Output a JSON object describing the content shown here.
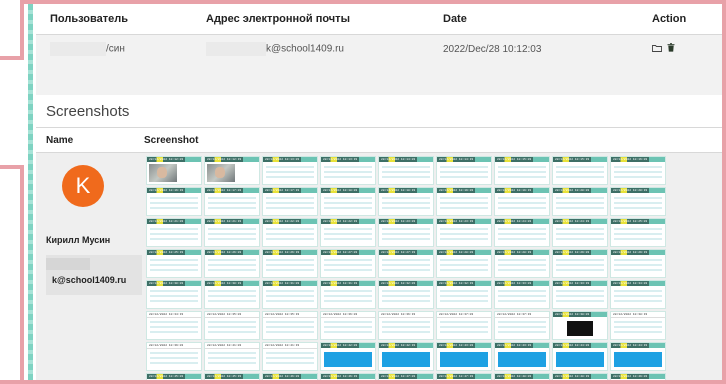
{
  "table": {
    "headers": {
      "user": "Пользователь",
      "email": "Адрес электронной почты",
      "date": "Date",
      "action": "Action"
    },
    "rows": [
      {
        "user_fragment": "/син",
        "email_fragment": "k@school1409.ru",
        "date": "2022/Dec/28 10:12:03"
      }
    ],
    "action_icons": [
      "folder-icon",
      "trash-icon"
    ]
  },
  "screenshots": {
    "title": "Screenshots",
    "headers": {
      "name": "Name",
      "screenshot": "Screenshot"
    },
    "profile": {
      "avatar_letter": "K",
      "name": "Кирилл Мусин",
      "email": "k@school1409.ru",
      "avatar_color": "#f06a1c"
    },
    "thumbnails": [
      {
        "time": "28/12/2022 10:12:03",
        "kind": "webcam"
      },
      {
        "time": "28/12/2022 10:12:33",
        "kind": "webcam"
      },
      {
        "time": "28/12/2022 10:13:03",
        "kind": "doc"
      },
      {
        "time": "28/12/2022 10:13:33",
        "kind": "doc"
      },
      {
        "time": "28/12/2022 10:14:03",
        "kind": "doc"
      },
      {
        "time": "28/12/2022 10:14:33",
        "kind": "doc"
      },
      {
        "time": "28/12/2022 10:15:03",
        "kind": "doc"
      },
      {
        "time": "28/12/2022 10:15:33",
        "kind": "doc"
      },
      {
        "time": "28/12/2022 10:16:03",
        "kind": "doc"
      },
      {
        "time": "28/12/2022 10:16:33",
        "kind": "doc"
      },
      {
        "time": "28/12/2022 10:17:03",
        "kind": "doc"
      },
      {
        "time": "28/12/2022 10:17:33",
        "kind": "doc"
      },
      {
        "time": "28/12/2022 10:18:03",
        "kind": "doc"
      },
      {
        "time": "28/12/2022 10:18:33",
        "kind": "doc"
      },
      {
        "time": "28/12/2022 10:19:03",
        "kind": "doc"
      },
      {
        "time": "28/12/2022 10:19:33",
        "kind": "doc"
      },
      {
        "time": "28/12/2022 10:20:03",
        "kind": "doc"
      },
      {
        "time": "28/12/2022 10:20:33",
        "kind": "doc"
      },
      {
        "time": "28/12/2022 10:21:03",
        "kind": "doc"
      },
      {
        "time": "28/12/2022 10:21:33",
        "kind": "doc"
      },
      {
        "time": "28/12/2022 10:22:03",
        "kind": "doc"
      },
      {
        "time": "28/12/2022 10:22:33",
        "kind": "doc"
      },
      {
        "time": "28/12/2022 10:23:03",
        "kind": "doc"
      },
      {
        "time": "28/12/2022 10:23:33",
        "kind": "doc"
      },
      {
        "time": "28/12/2022 10:24:03",
        "kind": "doc"
      },
      {
        "time": "28/12/2022 10:24:33",
        "kind": "doc"
      },
      {
        "time": "28/12/2022 10:25:03",
        "kind": "doc"
      },
      {
        "time": "28/12/2022 10:25:33",
        "kind": "doc"
      },
      {
        "time": "28/12/2022 10:26:03",
        "kind": "doc"
      },
      {
        "time": "28/12/2022 10:26:33",
        "kind": "doc"
      },
      {
        "time": "28/12/2022 10:27:03",
        "kind": "doc"
      },
      {
        "time": "28/12/2022 10:27:33",
        "kind": "doc"
      },
      {
        "time": "28/12/2022 10:28:03",
        "kind": "doc"
      },
      {
        "time": "28/12/2022 10:28:33",
        "kind": "doc"
      },
      {
        "time": "28/12/2022 10:29:03",
        "kind": "doc"
      },
      {
        "time": "28/12/2022 10:29:33",
        "kind": "doc"
      },
      {
        "time": "28/12/2022 10:30:03",
        "kind": "doc"
      },
      {
        "time": "28/12/2022 10:30:33",
        "kind": "doc"
      },
      {
        "time": "28/12/2022 10:31:03",
        "kind": "doc"
      },
      {
        "time": "28/12/2022 10:31:33",
        "kind": "doc"
      },
      {
        "time": "28/12/2022 10:32:03",
        "kind": "doc"
      },
      {
        "time": "28/12/2022 10:32:33",
        "kind": "doc"
      },
      {
        "time": "28/12/2022 10:33:03",
        "kind": "doc"
      },
      {
        "time": "28/12/2022 10:33:33",
        "kind": "doc"
      },
      {
        "time": "28/12/2022 10:34:03",
        "kind": "doc"
      },
      {
        "time": "28/12/2022 10:34:33",
        "kind": "plain"
      },
      {
        "time": "28/12/2022 10:35:03",
        "kind": "plain"
      },
      {
        "time": "28/12/2022 10:35:33",
        "kind": "plain"
      },
      {
        "time": "28/12/2022 10:36:03",
        "kind": "plain"
      },
      {
        "time": "28/12/2022 10:36:33",
        "kind": "plain"
      },
      {
        "time": "28/12/2022 10:37:03",
        "kind": "plain"
      },
      {
        "time": "28/12/2022 10:37:33",
        "kind": "plain"
      },
      {
        "time": "28/12/2022 10:38:03",
        "kind": "dark"
      },
      {
        "time": "28/12/2022 10:38:33",
        "kind": "plain"
      },
      {
        "time": "28/12/2022 10:39:03",
        "kind": "plain"
      },
      {
        "time": "28/12/2022 10:41:03",
        "kind": "plain"
      },
      {
        "time": "28/12/2022 10:41:33",
        "kind": "plain"
      },
      {
        "time": "28/12/2022 10:42:03",
        "kind": "blue"
      },
      {
        "time": "28/12/2022 10:42:33",
        "kind": "blue"
      },
      {
        "time": "28/12/2022 10:43:03",
        "kind": "blue"
      },
      {
        "time": "28/12/2022 10:43:33",
        "kind": "blue"
      },
      {
        "time": "28/12/2022 10:44:03",
        "kind": "blue"
      },
      {
        "time": "28/12/2022 10:44:33",
        "kind": "blue"
      },
      {
        "time": "28/12/2022 10:45:03",
        "kind": "doc"
      },
      {
        "time": "28/12/2022 10:45:33",
        "kind": "doc"
      },
      {
        "time": "28/12/2022 10:46:03",
        "kind": "doc"
      },
      {
        "time": "28/12/2022 10:46:33",
        "kind": "doc"
      },
      {
        "time": "28/12/2022 10:47:03",
        "kind": "doc"
      },
      {
        "time": "28/12/2022 10:47:33",
        "kind": "doc"
      },
      {
        "time": "28/12/2022 10:48:03",
        "kind": "doc"
      },
      {
        "time": "28/12/2022 10:48:33",
        "kind": "doc"
      },
      {
        "time": "28/12/2022 10:49:03",
        "kind": "doc"
      }
    ]
  },
  "colors": {
    "frame": "#e8a1a8",
    "accent": "#7fd3c2",
    "avatar": "#f06a1c"
  }
}
